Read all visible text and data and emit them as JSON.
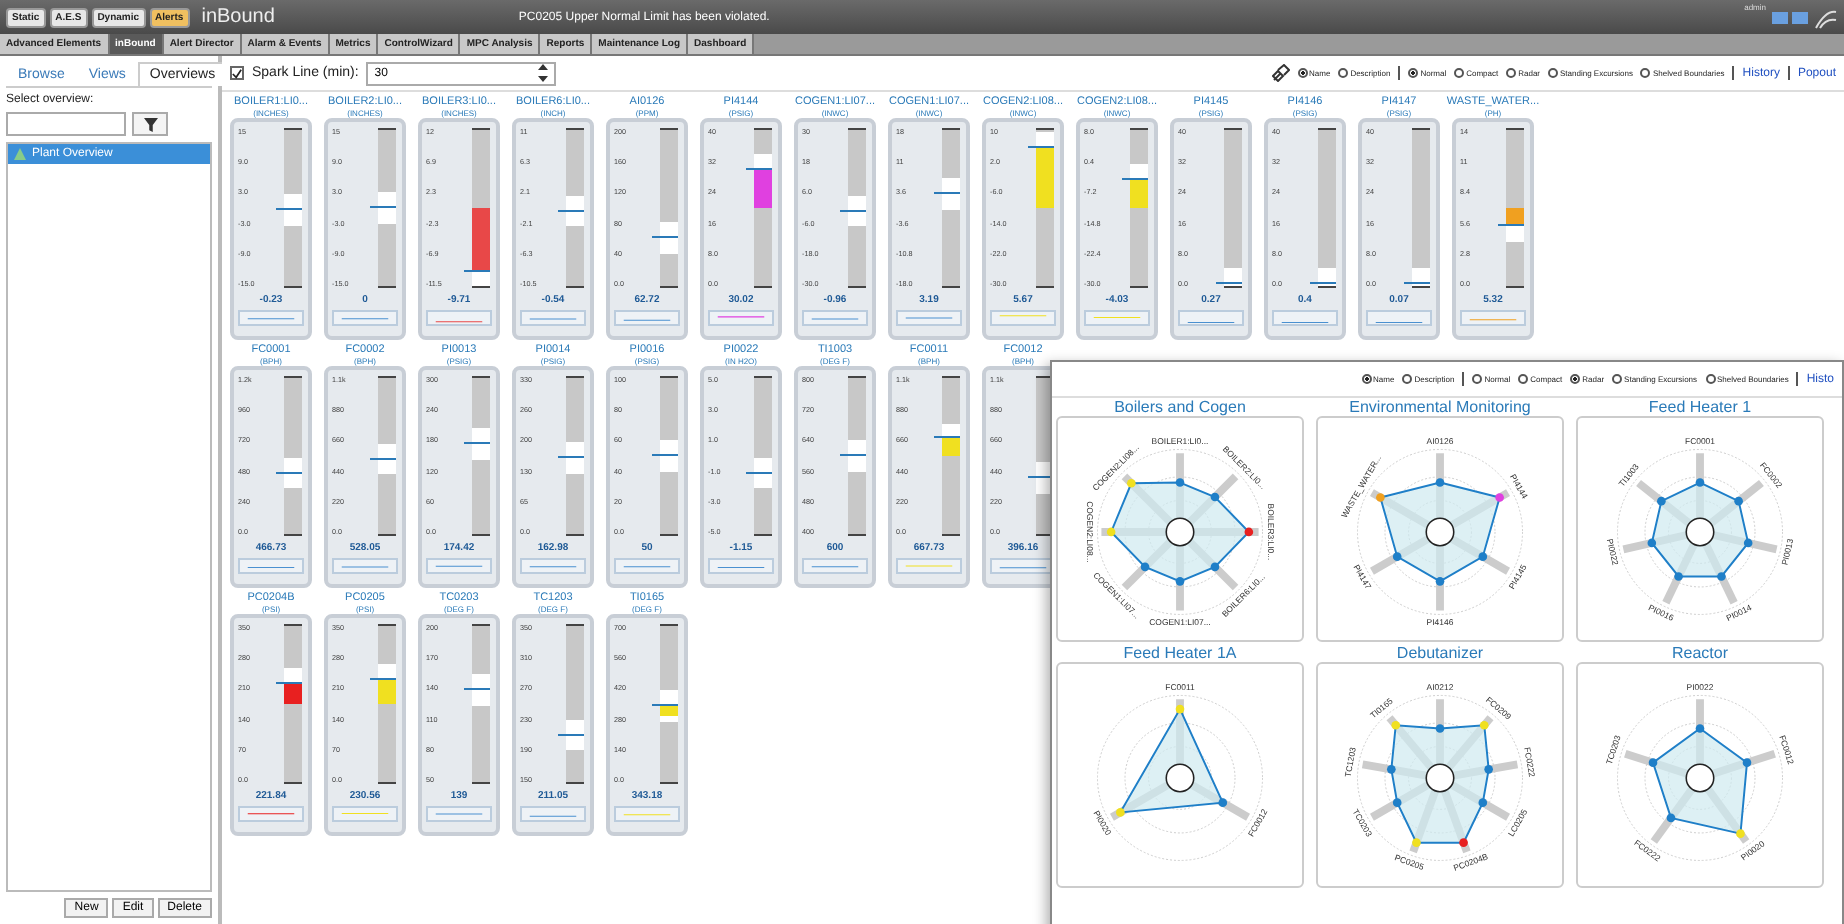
{
  "header": {
    "modes": [
      {
        "label": "Static",
        "selected": false
      },
      {
        "label": "A.E.S",
        "selected": false
      },
      {
        "label": "Dynamic",
        "selected": false
      },
      {
        "label": "Alerts",
        "selected": true
      }
    ],
    "app_title": "inBound",
    "message": "PC0205 Upper Normal Limit has been violated.",
    "user": "admin"
  },
  "menu": [
    {
      "label": "Advanced Elements",
      "selected": false
    },
    {
      "label": "inBound",
      "selected": true
    },
    {
      "label": "Alert Director",
      "selected": false
    },
    {
      "label": "Alarm & Events",
      "selected": false
    },
    {
      "label": "Metrics",
      "selected": false
    },
    {
      "label": "ControlWizard",
      "selected": false
    },
    {
      "label": "MPC Analysis",
      "selected": false
    },
    {
      "label": "Reports",
      "selected": false
    },
    {
      "label": "Maintenance Log",
      "selected": false
    },
    {
      "label": "Dashboard",
      "selected": false
    }
  ],
  "sidebar": {
    "tabs": [
      {
        "label": "Browse",
        "selected": false
      },
      {
        "label": "Views",
        "selected": false
      },
      {
        "label": "Overviews",
        "selected": true
      }
    ],
    "prompt": "Select overview:",
    "items": [
      {
        "label": "Plant Overview",
        "selected": true
      }
    ],
    "buttons": [
      "New",
      "Edit",
      "Delete"
    ]
  },
  "toolbar": {
    "spark_line": {
      "label": "Spark Line (min):",
      "checked": true,
      "value": "30"
    },
    "label_options": [
      {
        "label": "Name",
        "selected": true
      },
      {
        "label": "Description",
        "selected": false
      }
    ],
    "view_options": [
      {
        "label": "Normal",
        "selected": true
      },
      {
        "label": "Compact",
        "selected": false
      },
      {
        "label": "Radar",
        "selected": false
      },
      {
        "label": "Standing Excursions",
        "selected": false
      },
      {
        "label": "Shelved Boundaries",
        "selected": false
      }
    ],
    "links": [
      "History",
      "Popout"
    ]
  },
  "gauge_rows": [
    {
      "gauges": [
        {
          "name": "BOILER1:LI0...",
          "unit": "(INCHES)",
          "ticks": [
            "15",
            "9.0",
            "3.0",
            "-3.0",
            "-9.0",
            "-15.0"
          ],
          "value": "-0.23",
          "level": 0.49
        },
        {
          "name": "BOILER2:LI0...",
          "unit": "(INCHES)",
          "ticks": [
            "15",
            "9.0",
            "3.0",
            "-3.0",
            "-9.0",
            "-15.0"
          ],
          "value": "0",
          "level": 0.5
        },
        {
          "name": "BOILER3:LI0...",
          "unit": "(INCHES)",
          "ticks": [
            "12",
            "6.9",
            "2.3",
            "-2.3",
            "-6.9",
            "-11.5"
          ],
          "value": "-9.71",
          "level": 0.09,
          "color": "#e84848"
        },
        {
          "name": "BOILER6:LI0...",
          "unit": "(INCH)",
          "ticks": [
            "11",
            "6.3",
            "2.1",
            "-2.1",
            "-6.3",
            "-10.5"
          ],
          "value": "-0.54",
          "level": 0.48
        },
        {
          "name": "AI0126",
          "unit": "(PPM)",
          "ticks": [
            "200",
            "160",
            "120",
            "80",
            "40",
            "0.0"
          ],
          "value": "62.72",
          "level": 0.31
        },
        {
          "name": "PI4144",
          "unit": "(PSIG)",
          "ticks": [
            "40",
            "32",
            "24",
            "16",
            "8.0",
            "0.0"
          ],
          "value": "30.02",
          "level": 0.75,
          "color": "#e040e0"
        },
        {
          "name": "COGEN1:LI07...",
          "unit": "(INWC)",
          "ticks": [
            "30",
            "18",
            "6.0",
            "-6.0",
            "-18.0",
            "-30.0"
          ],
          "value": "-0.96",
          "level": 0.48
        },
        {
          "name": "COGEN1:LI07...",
          "unit": "(INWC)",
          "ticks": [
            "18",
            "11",
            "3.6",
            "-3.6",
            "-10.8",
            "-18.0"
          ],
          "value": "3.19",
          "level": 0.59
        },
        {
          "name": "COGEN2:LI08...",
          "unit": "(INWC)",
          "ticks": [
            "10",
            "2.0",
            "-6.0",
            "-14.0",
            "-22.0",
            "-30.0"
          ],
          "value": "5.67",
          "level": 0.89,
          "color": "#f0e020"
        },
        {
          "name": "COGEN2:LI08...",
          "unit": "(INWC)",
          "ticks": [
            "8.0",
            "0.4",
            "-7.2",
            "-14.8",
            "-22.4",
            "-30.0"
          ],
          "value": "-4.03",
          "level": 0.68,
          "color": "#f0e020"
        },
        {
          "name": "PI4145",
          "unit": "(PSIG)",
          "ticks": [
            "40",
            "32",
            "24",
            "16",
            "8.0",
            "0.0"
          ],
          "value": "0.27",
          "level": 0.01
        },
        {
          "name": "PI4146",
          "unit": "(PSIG)",
          "ticks": [
            "40",
            "32",
            "24",
            "16",
            "8.0",
            "0.0"
          ],
          "value": "0.4",
          "level": 0.01
        },
        {
          "name": "PI4147",
          "unit": "(PSIG)",
          "ticks": [
            "40",
            "32",
            "24",
            "16",
            "8.0",
            "0.0"
          ],
          "value": "0.07",
          "level": 0.01
        },
        {
          "name": "WASTE_WATER...",
          "unit": "(PH)",
          "ticks": [
            "14",
            "11",
            "8.4",
            "5.6",
            "2.8",
            "0.0"
          ],
          "value": "5.32",
          "level": 0.38,
          "color": "#f0a020"
        }
      ]
    },
    {
      "gauges": [
        {
          "name": "FC0001",
          "unit": "(BPH)",
          "ticks": [
            "1.2k",
            "960",
            "720",
            "480",
            "240",
            "0.0"
          ],
          "value": "466.73",
          "level": 0.39
        },
        {
          "name": "FC0002",
          "unit": "(BPH)",
          "ticks": [
            "1.1k",
            "880",
            "660",
            "440",
            "220",
            "0.0"
          ],
          "value": "528.05",
          "level": 0.48
        },
        {
          "name": "PI0013",
          "unit": "(PSIG)",
          "ticks": [
            "300",
            "240",
            "180",
            "120",
            "60",
            "0.0"
          ],
          "value": "174.42",
          "level": 0.58
        },
        {
          "name": "PI0014",
          "unit": "(PSIG)",
          "ticks": [
            "330",
            "260",
            "200",
            "130",
            "65",
            "0.0"
          ],
          "value": "162.98",
          "level": 0.49
        },
        {
          "name": "PI0016",
          "unit": "(PSIG)",
          "ticks": [
            "100",
            "80",
            "60",
            "40",
            "20",
            "0.0"
          ],
          "value": "50",
          "level": 0.5
        },
        {
          "name": "PI0022",
          "unit": "(IN H2O)",
          "ticks": [
            "5.0",
            "3.0",
            "1.0",
            "-1.0",
            "-3.0",
            "-5.0"
          ],
          "value": "-1.15",
          "level": 0.39
        },
        {
          "name": "TI1003",
          "unit": "(DEG F)",
          "ticks": [
            "800",
            "720",
            "640",
            "560",
            "480",
            "400"
          ],
          "value": "600",
          "level": 0.5
        },
        {
          "name": "FC0011",
          "unit": "(BPH)",
          "ticks": [
            "1.1k",
            "880",
            "660",
            "440",
            "220",
            "0.0"
          ],
          "value": "667.73",
          "level": 0.61,
          "color": "#f0e020"
        },
        {
          "name": "FC0012",
          "unit": "(BPH)",
          "ticks": [
            "1.1k",
            "880",
            "660",
            "440",
            "220",
            "0.0"
          ],
          "value": "396.16",
          "level": 0.36
        }
      ]
    },
    {
      "gauges": [
        {
          "name": "PC0204B",
          "unit": "(PSI)",
          "ticks": [
            "350",
            "280",
            "210",
            "140",
            "70",
            "0.0"
          ],
          "value": "221.84",
          "level": 0.63,
          "color": "#e82020"
        },
        {
          "name": "PC0205",
          "unit": "(PSI)",
          "ticks": [
            "350",
            "280",
            "210",
            "140",
            "70",
            "0.0"
          ],
          "value": "230.56",
          "level": 0.66,
          "color": "#f0e020"
        },
        {
          "name": "TC0203",
          "unit": "(DEG F)",
          "ticks": [
            "200",
            "170",
            "140",
            "110",
            "80",
            "50"
          ],
          "value": "139",
          "level": 0.59
        },
        {
          "name": "TC1203",
          "unit": "(DEG F)",
          "ticks": [
            "350",
            "310",
            "270",
            "230",
            "190",
            "150"
          ],
          "value": "211.05",
          "level": 0.3
        },
        {
          "name": "TI0165",
          "unit": "(DEG F)",
          "ticks": [
            "700",
            "560",
            "420",
            "280",
            "140",
            "0.0"
          ],
          "value": "343.18",
          "level": 0.49,
          "color": "#f0e020"
        }
      ]
    }
  ],
  "popup": {
    "label_options": [
      {
        "label": "Name",
        "selected": true
      },
      {
        "label": "Description",
        "selected": false
      }
    ],
    "view_options": [
      {
        "label": "Normal",
        "selected": false
      },
      {
        "label": "Compact",
        "selected": false
      },
      {
        "label": "Radar",
        "selected": true
      },
      {
        "label": "Standing Excursions",
        "selected": false
      },
      {
        "label": "Shelved Boundaries",
        "selected": false
      }
    ],
    "links": [
      "Histo"
    ],
    "radars": [
      {
        "title": "Boilers and Cogen",
        "axes": [
          {
            "label": "BOILER1:LI0..."
          },
          {
            "label": "BOILER2:LI0..."
          },
          {
            "label": "BOILER3:LI0...",
            "color": "#e82020"
          },
          {
            "label": "BOILER6:LI0..."
          },
          {
            "label": "COGEN1:LI07..."
          },
          {
            "label": "COGEN1:LI07..."
          },
          {
            "label": "COGEN2:LI08...",
            "color": "#f0e020"
          },
          {
            "label": "COGEN2:LI08...",
            "color": "#f0e020"
          }
        ]
      },
      {
        "title": "Environmental Monitoring",
        "axes": [
          {
            "label": "AI0126"
          },
          {
            "label": "PI4144",
            "color": "#e040e0"
          },
          {
            "label": "PI4145"
          },
          {
            "label": "PI4146"
          },
          {
            "label": "PI4147"
          },
          {
            "label": "WASTE_WATER...",
            "color": "#f0a020"
          }
        ]
      },
      {
        "title": "Feed Heater 1",
        "axes": [
          {
            "label": "FC0001"
          },
          {
            "label": "FC0002"
          },
          {
            "label": "PI0013"
          },
          {
            "label": "PI0014"
          },
          {
            "label": "PI0016"
          },
          {
            "label": "PI0022"
          },
          {
            "label": "TI1003"
          }
        ]
      },
      {
        "title": "Feed Heater 1A",
        "axes": [
          {
            "label": "FC0011",
            "color": "#f0e020"
          },
          {
            "label": "FC0012"
          },
          {
            "label": "PI0020",
            "color": "#f0e020"
          }
        ]
      },
      {
        "title": "Debutanizer",
        "axes": [
          {
            "label": "AI0212"
          },
          {
            "label": "FC0209",
            "color": "#f0e020"
          },
          {
            "label": "FC0222"
          },
          {
            "label": "LC0205"
          },
          {
            "label": "PC0204B",
            "color": "#e82020"
          },
          {
            "label": "PC0205",
            "color": "#f0e020"
          },
          {
            "label": "TC0203"
          },
          {
            "label": "TC1203"
          },
          {
            "label": "TI0165",
            "color": "#f0e020"
          }
        ]
      },
      {
        "title": "Reactor",
        "axes": [
          {
            "label": "PI0022"
          },
          {
            "label": "FC0012"
          },
          {
            "label": "PI0020",
            "color": "#f0e020"
          },
          {
            "label": "FC0222"
          },
          {
            "label": "TC0203"
          }
        ]
      }
    ]
  }
}
